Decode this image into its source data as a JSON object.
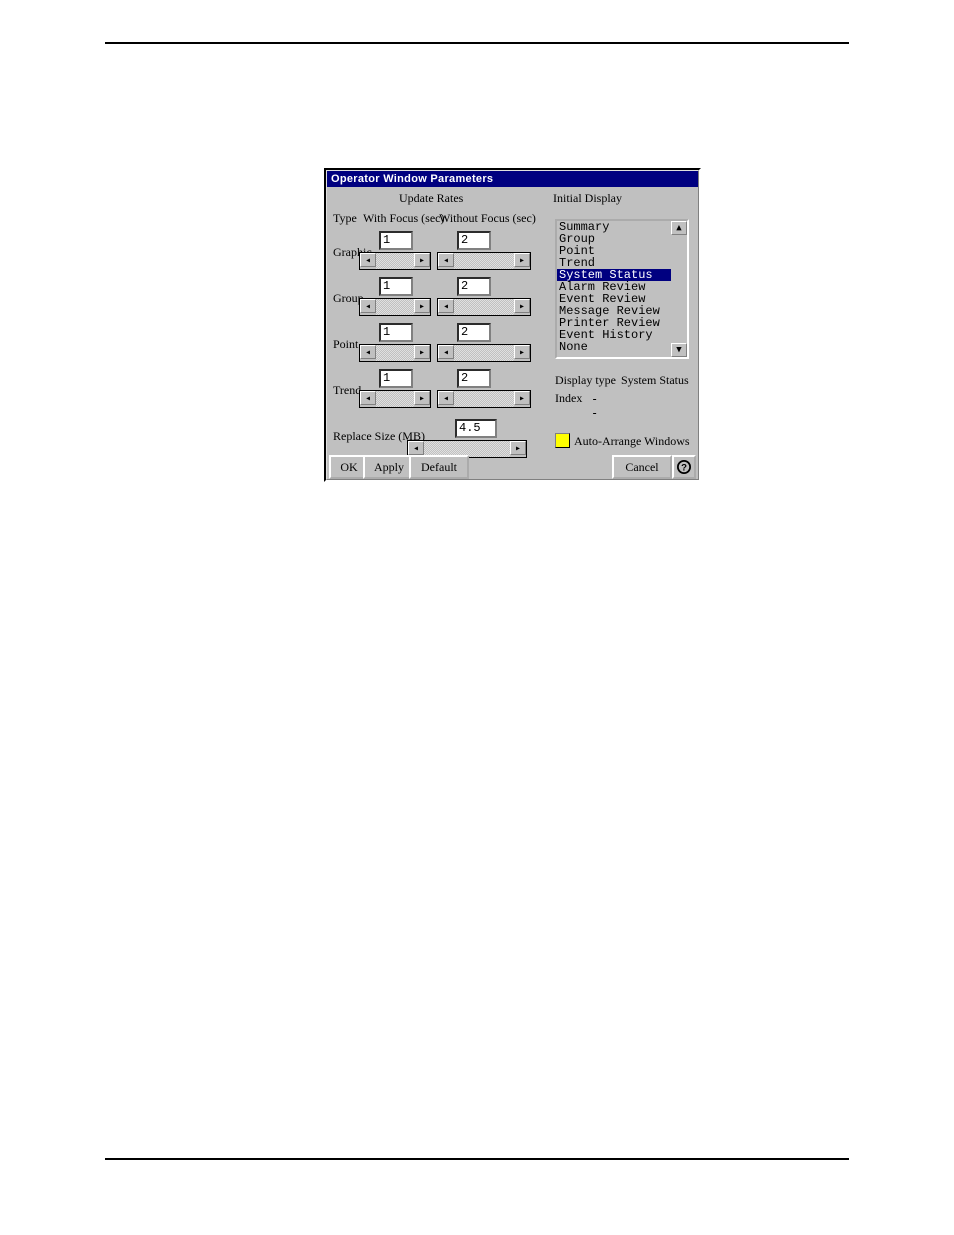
{
  "dialog": {
    "title": "Operator Window Parameters",
    "update_rates_heading": "Update Rates",
    "initial_display_heading": "Initial Display",
    "columns": {
      "type": "Type",
      "with_focus": "With Focus (sec)",
      "without_focus": "Without Focus (sec)"
    },
    "rows": [
      {
        "label": "Graphic",
        "with_focus": "1",
        "without_focus": "2"
      },
      {
        "label": "Group",
        "with_focus": "1",
        "without_focus": "2"
      },
      {
        "label": "Point",
        "with_focus": "1",
        "without_focus": "2"
      },
      {
        "label": "Trend",
        "with_focus": "1",
        "without_focus": "2"
      }
    ],
    "replace_size": {
      "label": "Replace Size (MB)",
      "value": "4.5"
    },
    "display_list": {
      "items": [
        "Summary",
        "Group",
        "Point",
        "Trend",
        "System Status",
        "Alarm Review",
        "Event Review",
        "Message Review",
        "Printer Review",
        "Event History",
        "None"
      ],
      "selected_index": 4
    },
    "display_type": {
      "label": "Display type",
      "value": "System Status"
    },
    "index": {
      "label": "Index",
      "value": "--"
    },
    "auto_arrange": {
      "label": "Auto-Arrange Windows",
      "checked": false
    },
    "buttons": {
      "ok": "OK",
      "apply": "Apply",
      "default": "Default",
      "cancel": "Cancel"
    }
  }
}
